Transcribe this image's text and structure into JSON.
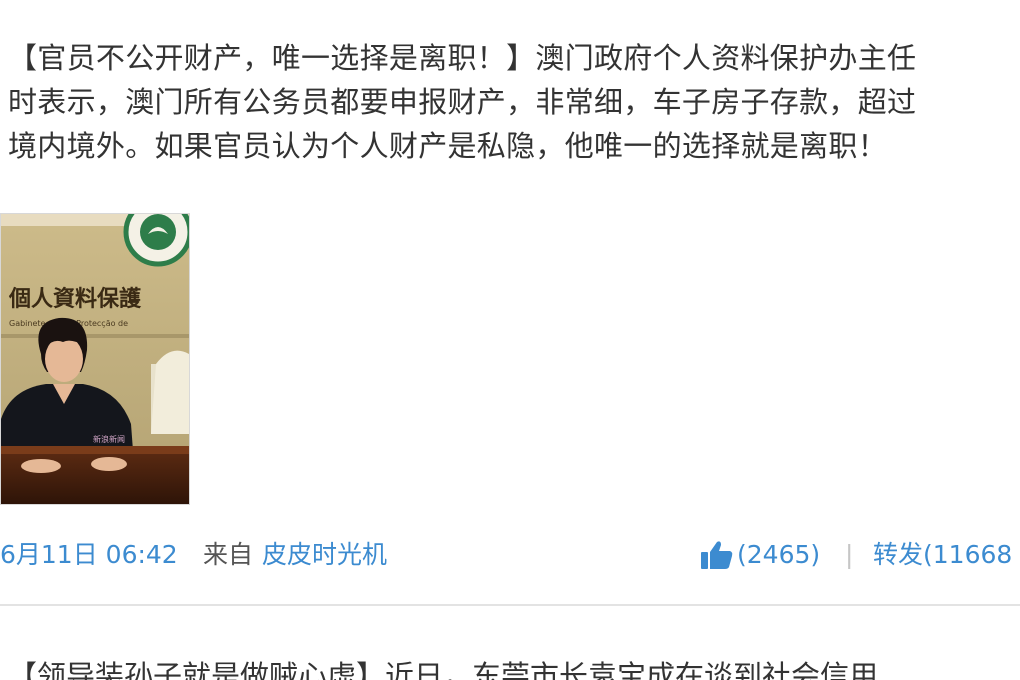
{
  "post": {
    "lines": [
      "【官员不公开财产，唯一选择是离职！】澳门政府个人资料保护办主任",
      "时表示，澳门所有公务员都要申报财产，非常细，车子房子存款，超过",
      "境内境外。如果官员认为个人财产是私隐，他唯一的选择就是离职！"
    ],
    "image": {
      "sign_text": "個人資料保護",
      "sign_subtext": "Gabinete para a Protecção de",
      "watermark": "新浪新闻"
    },
    "meta": {
      "timestamp": "6月11日 06:42",
      "from_label": "来自",
      "source": "皮皮时光机",
      "likes": "(2465)",
      "separator": "|",
      "repost": "转发(11668"
    }
  },
  "next_post": {
    "text": "【领导装孙子就是做贼心虚】近日，东莞市长袁宝成在谈到社会信用"
  },
  "colors": {
    "link": "#3c8bd0",
    "text": "#333333",
    "divider": "#e3e3e3"
  }
}
